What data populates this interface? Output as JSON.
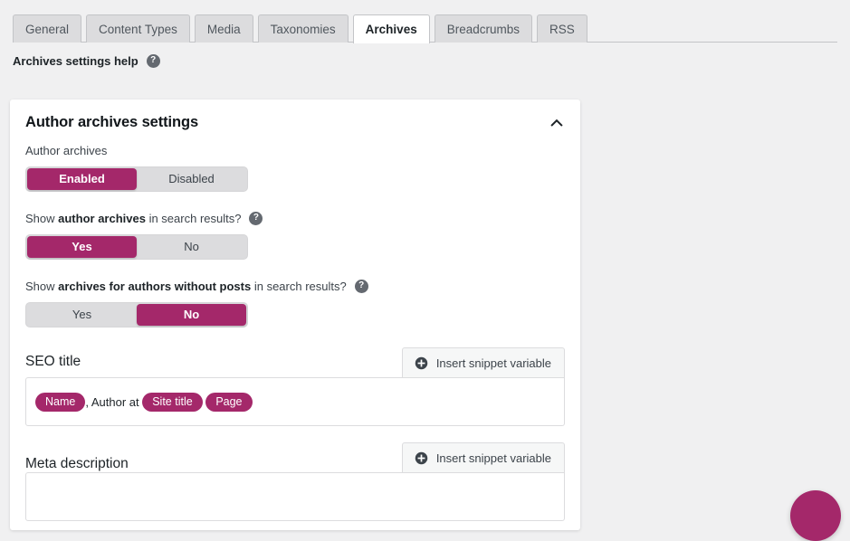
{
  "tabs": [
    {
      "label": "General",
      "active": false
    },
    {
      "label": "Content Types",
      "active": false
    },
    {
      "label": "Media",
      "active": false
    },
    {
      "label": "Taxonomies",
      "active": false
    },
    {
      "label": "Archives",
      "active": true
    },
    {
      "label": "Breadcrumbs",
      "active": false
    },
    {
      "label": "RSS",
      "active": false
    }
  ],
  "help_row": {
    "label": "Archives settings help",
    "icon": "help-icon",
    "icon_glyph": "?"
  },
  "card": {
    "title": "Author archives settings",
    "collapse_icon": "chevron-up-icon",
    "fields": {
      "author_archives": {
        "label": "Author archives",
        "options": [
          "Enabled",
          "Disabled"
        ],
        "selected": "Enabled"
      },
      "show_author_archives": {
        "label_parts": [
          "Show ",
          "author archives",
          " in search results?"
        ],
        "has_help": true,
        "options": [
          "Yes",
          "No"
        ],
        "selected": "Yes"
      },
      "show_archives_without_posts": {
        "label_parts": [
          "Show ",
          "archives for authors without posts",
          " in search results?"
        ],
        "has_help": true,
        "options": [
          "Yes",
          "No"
        ],
        "selected": "No"
      }
    },
    "seo_title": {
      "title": "SEO title",
      "insert_button": {
        "label": "Insert snippet variable",
        "icon": "plus-circle-icon"
      },
      "value_tokens": [
        {
          "type": "variable",
          "text": "Name"
        },
        {
          "type": "text",
          "text": ", Author at "
        },
        {
          "type": "variable",
          "text": "Site title"
        },
        {
          "type": "text",
          "text": " "
        },
        {
          "type": "variable",
          "text": "Page"
        }
      ]
    },
    "meta_description": {
      "title": "Meta description",
      "insert_button": {
        "label": "Insert snippet variable",
        "icon": "plus-circle-icon"
      }
    }
  },
  "fab": {
    "name": "help-bubble-button"
  },
  "colors": {
    "accent": "#a4286a",
    "page_bg": "#f0f0f1",
    "card_bg": "#ffffff",
    "tab_bg": "#dcdcde",
    "border": "#c3c4c7",
    "text": "#1d2327",
    "muted_text": "#3c434a"
  }
}
